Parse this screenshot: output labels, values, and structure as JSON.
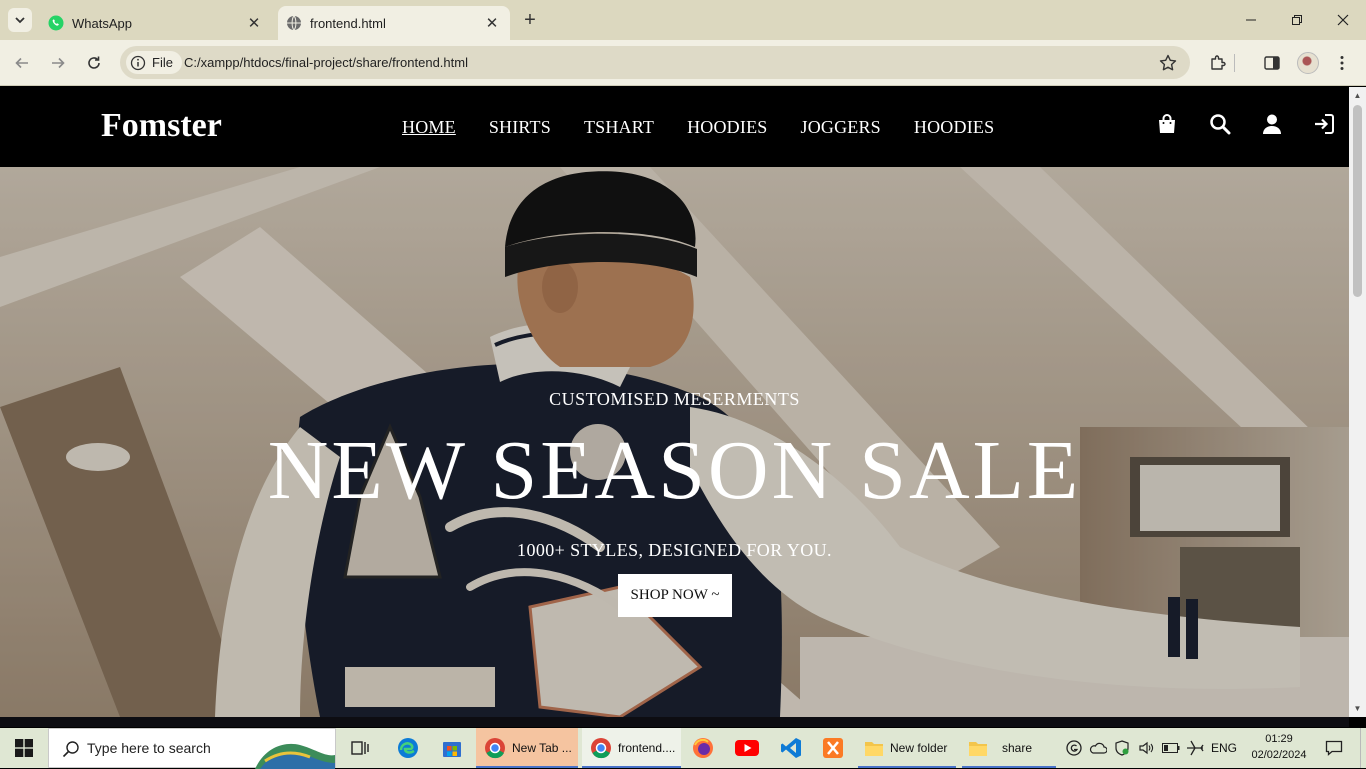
{
  "browser": {
    "tabs": [
      {
        "label": "WhatsApp",
        "icon": "whatsapp-icon"
      },
      {
        "label": "frontend.html",
        "icon": "globe-icon"
      }
    ],
    "address": {
      "chip_label": "File",
      "url": "C:/xampp/htdocs/final-project/share/frontend.html"
    }
  },
  "site": {
    "brand": "Fomster",
    "nav": [
      "HOME",
      "SHIRTS",
      "TSHART",
      "HOODIES",
      "JOGGERS",
      "HOODIES"
    ],
    "header_icons": [
      "shopping-bag-icon",
      "search-icon",
      "user-icon",
      "sign-in-icon"
    ],
    "hero": {
      "subtitle": "CUSTOMISED MESERMENTS",
      "title": "NEW SEASON SALE",
      "tagline": "1000+ STYLES, DESIGNED FOR YOU.",
      "button": "SHOP NOW ~"
    }
  },
  "taskbar": {
    "search_placeholder": "Type here to search",
    "apps": [
      {
        "name": "task-view-icon"
      },
      {
        "name": "edge-icon"
      },
      {
        "name": "store-icon"
      },
      {
        "name": "chrome-icon",
        "label": "New Tab ..."
      },
      {
        "name": "chrome-icon",
        "label": "frontend...."
      },
      {
        "name": "firefox-icon"
      },
      {
        "name": "youtube-icon"
      },
      {
        "name": "vscode-icon"
      },
      {
        "name": "xampp-icon"
      },
      {
        "name": "folder-icon",
        "label": "New folder"
      },
      {
        "name": "folder-icon",
        "label": "share"
      }
    ],
    "tray": {
      "language": "ENG",
      "time": "01:29",
      "date": "02/02/2024"
    }
  },
  "colors": {
    "browser_frame": "#dcd8bf",
    "toolbar": "#f1efe3",
    "site_header": "#000000",
    "hero_text": "#ffffff",
    "taskbar": "#dfe7d3",
    "active_taskbar_app": "#f5c4a0"
  }
}
